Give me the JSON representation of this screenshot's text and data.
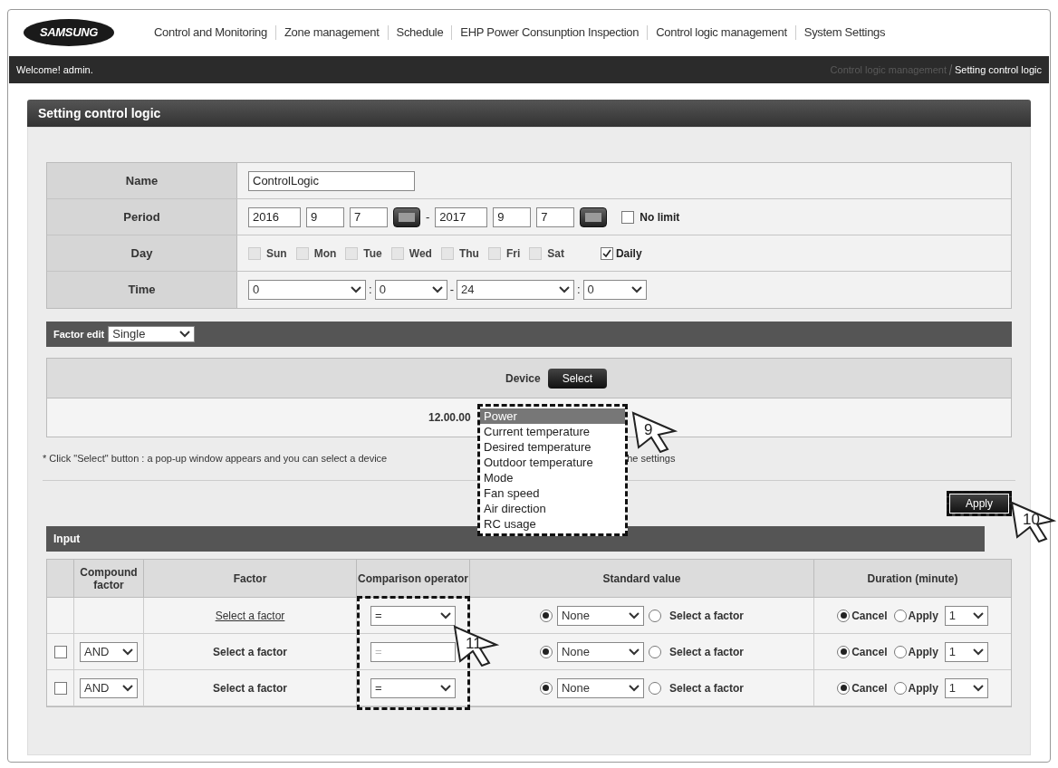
{
  "logo": "SAMSUNG",
  "nav": [
    "Control and Monitoring",
    "Zone management",
    "Schedule",
    "EHP Power Consunption Inspection",
    "Control logic management",
    "System Settings"
  ],
  "welcome": "Welcome! admin.",
  "breadcrumb": {
    "parent": "Control logic management",
    "current": "Setting control logic"
  },
  "page_title": "Setting control logic",
  "form": {
    "name": {
      "label": "Name",
      "value": "ControlLogic"
    },
    "period": {
      "label": "Period",
      "start": [
        "2016",
        "9",
        "7"
      ],
      "separator": "-",
      "end": [
        "2017",
        "9",
        "7"
      ],
      "no_limit": {
        "label": "No limit",
        "checked": false
      }
    },
    "day": {
      "label": "Day",
      "days": [
        {
          "label": "Sun",
          "checked": false,
          "disabled": true
        },
        {
          "label": "Mon",
          "checked": false,
          "disabled": true
        },
        {
          "label": "Tue",
          "checked": false,
          "disabled": true
        },
        {
          "label": "Wed",
          "checked": false,
          "disabled": true
        },
        {
          "label": "Thu",
          "checked": false,
          "disabled": true
        },
        {
          "label": "Fri",
          "checked": false,
          "disabled": true
        },
        {
          "label": "Sat",
          "checked": false,
          "disabled": true
        }
      ],
      "daily": {
        "label": "Daily",
        "checked": true
      }
    },
    "time": {
      "label": "Time",
      "start_hour": "0",
      "start_minute": "0",
      "separator": "-",
      "end_hour": "24",
      "end_minute": "0",
      "colon": ":"
    }
  },
  "factor_edit": {
    "label": "Factor edit",
    "value": "Single"
  },
  "device": {
    "label": "Device",
    "button": "Select",
    "value": "12.00.00"
  },
  "factor_list": [
    {
      "label": "Power",
      "selected": true
    },
    {
      "label": "Current temperature",
      "selected": false
    },
    {
      "label": "Desired temperature",
      "selected": false
    },
    {
      "label": "Outdoor temperature",
      "selected": false
    },
    {
      "label": "Mode",
      "selected": false
    },
    {
      "label": "Fan speed",
      "selected": false
    },
    {
      "label": "Air direction",
      "selected": false
    },
    {
      "label": "RC usage",
      "selected": false
    }
  ],
  "note": {
    "before": "* Click \"Select\" button : a pop-up window appears and you can select a device",
    "after": "he settings"
  },
  "apply_button": "Apply",
  "callouts": [
    "9",
    "10",
    "11"
  ],
  "input": {
    "title": "Input",
    "columns": [
      "Compound factor",
      "Factor",
      "Comparison operator",
      "Standard value",
      "Duration (minute)"
    ],
    "rows": [
      {
        "kind": "base",
        "factor": "Select a factor",
        "operator": {
          "value": "=",
          "disabled": false
        },
        "standard": {
          "none_selected": true,
          "value": "None",
          "factor_label": "Select a factor"
        },
        "duration": {
          "cancel_label": "Cancel",
          "apply_label": "Apply",
          "cancel_selected": true,
          "value": "1"
        }
      },
      {
        "kind": "compound",
        "checked": false,
        "compound": "AND",
        "factor": "Select a factor",
        "operator": {
          "value": "=",
          "disabled": true
        },
        "standard": {
          "none_selected": true,
          "value": "None",
          "factor_label": "Select a factor"
        },
        "duration": {
          "cancel_label": "Cancel",
          "apply_label": "Apply",
          "cancel_selected": true,
          "value": "1"
        }
      },
      {
        "kind": "compound",
        "checked": false,
        "compound": "AND",
        "factor": "Select a factor",
        "operator": {
          "value": "=",
          "disabled": false
        },
        "standard": {
          "none_selected": true,
          "value": "None",
          "factor_label": "Select a factor"
        },
        "duration": {
          "cancel_label": "Cancel",
          "apply_label": "Apply",
          "cancel_selected": true,
          "value": "1"
        }
      }
    ]
  }
}
